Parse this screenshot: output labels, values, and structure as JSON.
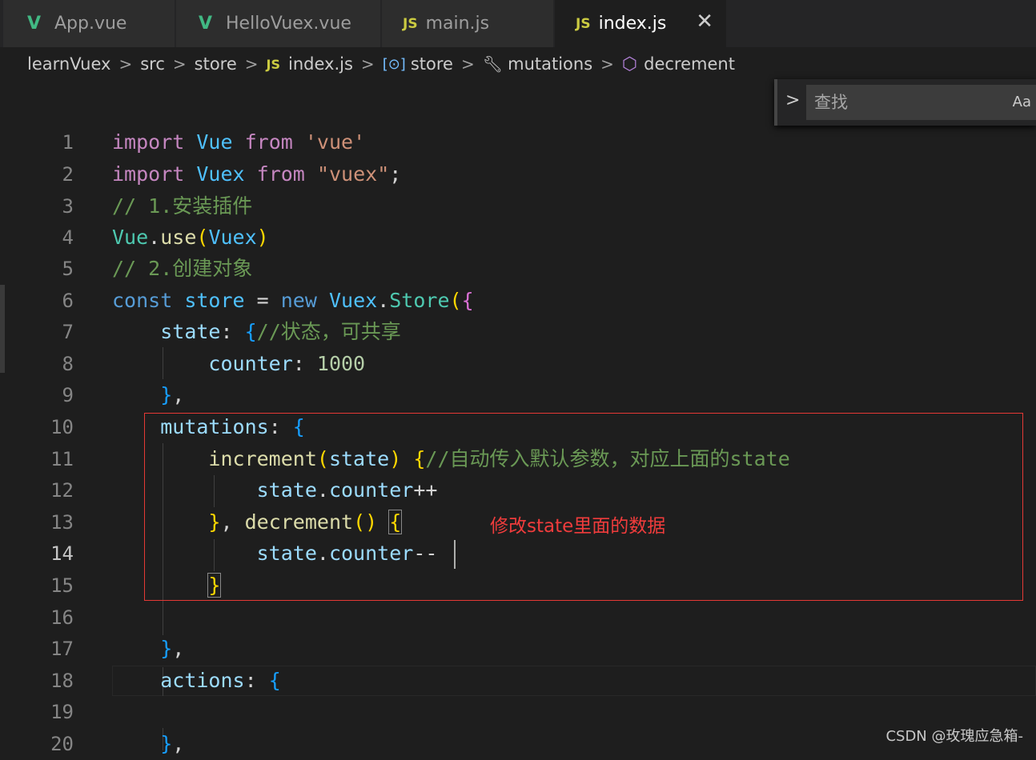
{
  "tabs": [
    {
      "label": "App.vue",
      "icon": "vue-icon",
      "active": false
    },
    {
      "label": "HelloVuex.vue",
      "icon": "vue-icon",
      "active": false
    },
    {
      "label": "main.js",
      "icon": "js-icon",
      "active": false
    },
    {
      "label": "index.js",
      "icon": "js-icon",
      "active": true
    }
  ],
  "tab_close_glyph": "✕",
  "breadcrumb": {
    "project": "learnVuex",
    "folder1": "src",
    "folder2": "store",
    "file": "index.js",
    "symbol1": "store",
    "symbol2": "mutations",
    "symbol3": "decrement",
    "js_badge": "JS"
  },
  "find": {
    "placeholder": "查找",
    "match_case_label": "Aa"
  },
  "editor": {
    "current_line": 14,
    "line_numbers": [
      "1",
      "2",
      "3",
      "4",
      "5",
      "6",
      "7",
      "8",
      "9",
      "10",
      "11",
      "12",
      "13",
      "14",
      "15",
      "16",
      "17",
      "18",
      "19",
      "20"
    ],
    "annotation": "修改state里面的数据"
  },
  "code_lines": [
    "import Vue from 'vue'",
    "import Vuex from \"vuex\";",
    "// 1.安装插件",
    "Vue.use(Vuex)",
    "// 2.创建对象",
    "const store = new Vuex.Store({",
    "    state: {//状态，可共享",
    "        counter: 1000",
    "    },",
    "    mutations: {",
    "        increment(state) {//自动传入默认参数，对应上面的state",
    "            state.counter++",
    "        }, decrement() {",
    "            state.counter--",
    "        }",
    "",
    "    },",
    "    actions: {",
    "",
    "    },"
  ],
  "watermark": "CSDN @玫瑰应急箱-",
  "colors": {
    "keyword": "#c586c0",
    "string": "#ce9178",
    "comment": "#6a9955",
    "storage": "#569cd6",
    "variable": "#4fc1ff",
    "class": "#4ec9b0",
    "function": "#dcdcaa",
    "property": "#9cdcfe",
    "number": "#b5cea8",
    "annotation_red": "#e53935"
  }
}
